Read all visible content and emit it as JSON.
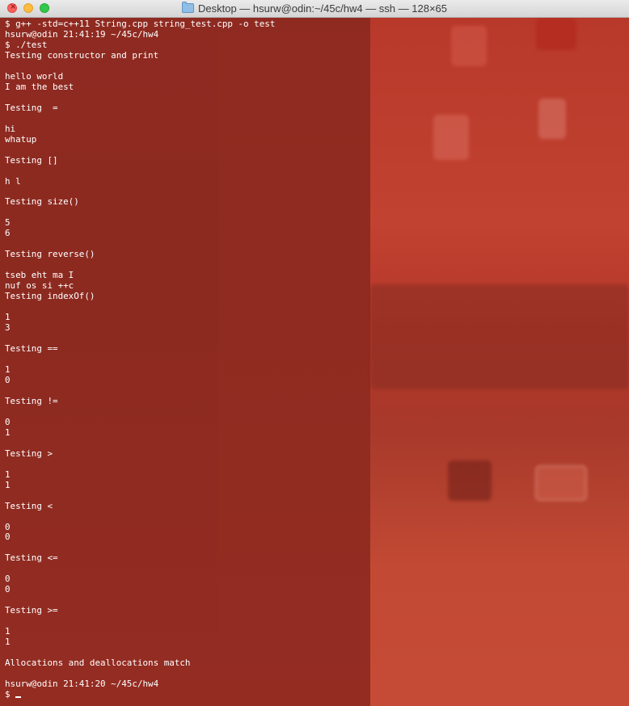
{
  "window": {
    "title": "Desktop — hsurw@odin:~/45c/hw4 — ssh — 128×65",
    "title_icon": "folder-icon",
    "colors": {
      "background": "#8e2a20",
      "text": "#ffffff",
      "close": "#fc605c",
      "minimize": "#fdbc40",
      "maximize": "#34c84a"
    }
  },
  "terminal": {
    "lines": [
      "$ g++ -std=c++11 String.cpp string_test.cpp -o test",
      "hsurw@odin 21:41:19 ~/45c/hw4",
      "$ ./test",
      "Testing constructor and print",
      "",
      "hello world",
      "I am the best",
      "",
      "Testing  =",
      "",
      "hi",
      "whatup",
      "",
      "Testing []",
      "",
      "h l",
      "",
      "Testing size()",
      "",
      "5",
      "6",
      "",
      "Testing reverse()",
      "",
      "tseb eht ma I",
      "nuf os si ++c",
      "Testing indexOf()",
      "",
      "1",
      "3",
      "",
      "Testing ==",
      "",
      "1",
      "0",
      "",
      "Testing !=",
      "",
      "0",
      "1",
      "",
      "Testing >",
      "",
      "1",
      "1",
      "",
      "Testing <",
      "",
      "0",
      "0",
      "",
      "Testing <=",
      "",
      "0",
      "0",
      "",
      "Testing >=",
      "",
      "1",
      "1",
      "",
      "Allocations and deallocations match",
      "",
      "hsurw@odin 21:41:20 ~/45c/hw4"
    ],
    "prompt": "$ "
  }
}
